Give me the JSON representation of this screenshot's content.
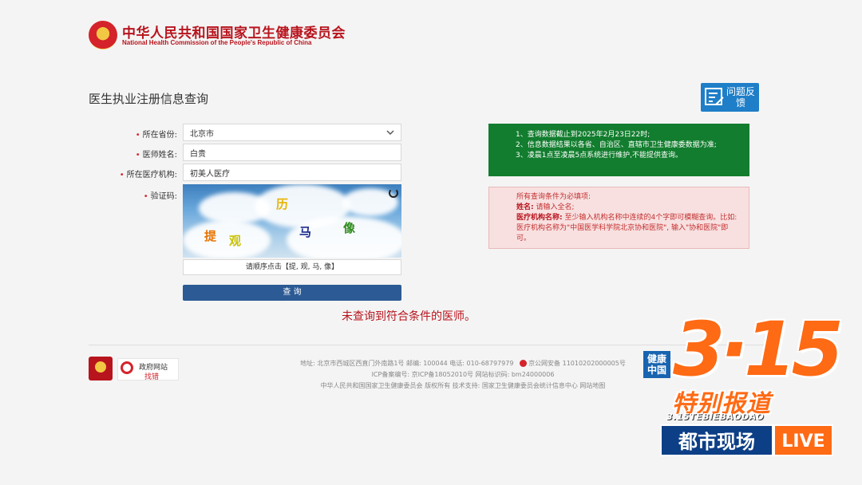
{
  "header": {
    "org_cn": "中华人民共和国国家卫生健康委员会",
    "org_en": "National Health Commission of the People's Republic of China"
  },
  "page_title": "医生执业注册信息查询",
  "feedback": {
    "label": "问题反馈"
  },
  "form": {
    "province_label": "所在省份:",
    "province_value": "北京市",
    "name_label": "医师姓名:",
    "name_value": "白贵",
    "institution_label": "所在医疗机构:",
    "institution_value": "初美人医疗",
    "captcha_label": "验证码:",
    "captcha_chars": [
      "历",
      "提",
      "观",
      "马",
      "像"
    ],
    "captcha_hint": "请顺序点击【提, 观, 马, 像】",
    "query_button": "查 询",
    "no_result": "未查询到符合条件的医师。"
  },
  "notice_green": [
    "1、查询数据截止到2025年2月23日22时;",
    "2、信息数据结果以各省、自治区、直辖市卫生健康委数据为准;",
    "3、凌晨1点至凌晨5点系统进行维护,不能提供查询。"
  ],
  "notice_pink": {
    "line1": "所有查询条件为必填项:",
    "name_key": "姓名:",
    "name_text": "请输入全名;",
    "inst_key": "医疗机构名称:",
    "inst_text": "至少输入机构名称中连续的4个字即可模糊查询。比如: 医疗机构名称为\"中国医学科学院北京协和医院\", 输入\"协和医院\"即可。"
  },
  "footer": {
    "gov_site_top": "政府网站",
    "gov_site_bottom": "找错",
    "line1": "地址: 北京市西城区西直门外南路1号    邮编: 100044    电话: 010-68797979",
    "police": "京公网安备 11010202000005号",
    "line2": "ICP备案编号: 京ICP备18052010号    网站标识码: bm24000006",
    "line3": "中华人民共和国国家卫生健康委员会    版权所有    技术支持: 国家卫生健康委员会统计信息中心    网站地图",
    "health_logo": "健康中国"
  },
  "overlay": {
    "brand": "3·15",
    "special": "特别报道",
    "pinyin": "3.15TEBIEBAODAO",
    "program": "都市现场",
    "live": "LIVE"
  },
  "colors": {
    "accent_red": "#b8141d",
    "button_blue": "#2c5a94",
    "notice_green": "#127d2e",
    "overlay_orange": "#ff6a14"
  }
}
